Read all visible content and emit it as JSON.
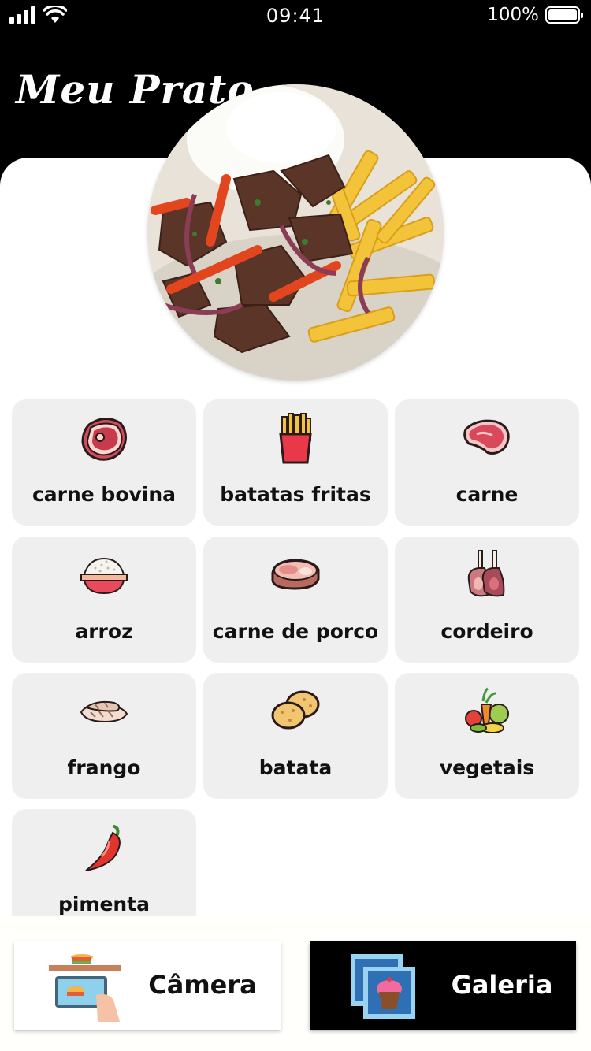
{
  "status_bar": {
    "time": "09:41",
    "battery_percent_label": "100%",
    "battery_level": 1.0,
    "icons": [
      "signal-icon",
      "wifi-icon",
      "battery-icon"
    ]
  },
  "header": {
    "title": "Meu Prato"
  },
  "ingredients": [
    {
      "label": "carne bovina",
      "icon": "steak-icon"
    },
    {
      "label": "batatas fritas",
      "icon": "fries-icon"
    },
    {
      "label": "carne",
      "icon": "meat-icon"
    },
    {
      "label": "arroz",
      "icon": "rice-bowl-icon"
    },
    {
      "label": "carne de porco",
      "icon": "pork-icon"
    },
    {
      "label": "cordeiro",
      "icon": "lamb-chops-icon"
    },
    {
      "label": "frango",
      "icon": "chicken-icon"
    },
    {
      "label": "batata",
      "icon": "potato-icon"
    },
    {
      "label": "vegetais",
      "icon": "vegetables-icon"
    },
    {
      "label": "pimenta",
      "icon": "pepper-icon"
    }
  ],
  "actions": {
    "camera_label": "Câmera",
    "gallery_label": "Galeria"
  },
  "colors": {
    "header_bg": "#000000",
    "card_bg": "#efefef",
    "accent_red": "#d8334a"
  }
}
